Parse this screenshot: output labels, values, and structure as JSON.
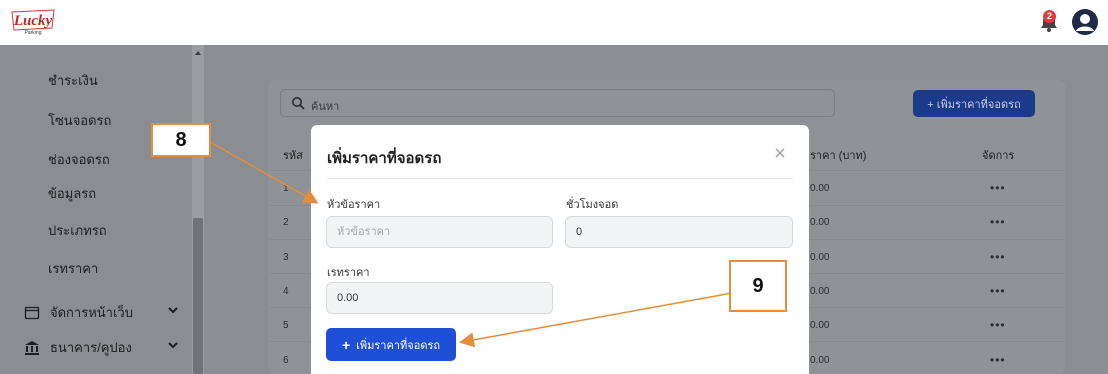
{
  "header": {
    "logo_text": "Lucky",
    "logo_sub": "Parking",
    "notification_count": "2"
  },
  "sidebar": {
    "items": [
      {
        "label": "ชำระเงิน"
      },
      {
        "label": "โซนจอดรถ"
      },
      {
        "label": "ช่องจอดรถ"
      },
      {
        "label": "ข้อมูลรถ"
      },
      {
        "label": "ประเภทรถ"
      },
      {
        "label": "เรทราคา"
      }
    ],
    "groups": [
      {
        "label": "จัดการหน้าเว็บ",
        "icon": "window-icon"
      },
      {
        "label": "ธนาคาร/คูปอง",
        "icon": "bank-icon"
      }
    ]
  },
  "main": {
    "search_placeholder": "ค้นหา",
    "add_button_label": "+ เพิ่มราคาที่จอดรถ",
    "columns": {
      "id": "รหัส",
      "price": "ราคา (บาท)",
      "manage": "จัดการ"
    },
    "rows": [
      {
        "no": "1",
        "price": "0.00",
        "actions": "•••"
      },
      {
        "no": "2",
        "price": "0.00",
        "actions": "•••"
      },
      {
        "no": "3",
        "price": "0.00",
        "actions": "•••"
      },
      {
        "no": "4",
        "price": "0.00",
        "actions": "•••"
      },
      {
        "no": "5",
        "price": "0.00",
        "actions": "•••"
      },
      {
        "no": "6",
        "price": "0.00",
        "actions": "•••"
      }
    ]
  },
  "modal": {
    "title": "เพิ่มราคาที่จอดรถ",
    "fields": {
      "title_label": "หัวข้อราคา",
      "title_placeholder": "หัวข้อราคา",
      "hours_label": "ชั่วโมงจอด",
      "hours_value": "0",
      "rate_label": "เรทราคา",
      "rate_value": "0.00"
    },
    "submit_label": "เพิ่มราคาที่จอดรถ"
  },
  "annotations": {
    "a8": "8",
    "a9": "9"
  },
  "colors": {
    "accent": "#1f4fd6",
    "annotation": "#e58d3b",
    "notification": "#e13b3b"
  }
}
